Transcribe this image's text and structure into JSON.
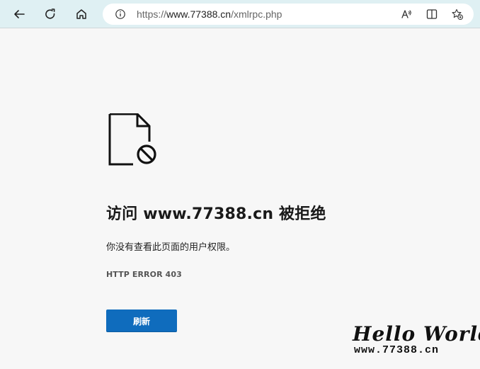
{
  "browser": {
    "address": {
      "prefix": "https://",
      "host": "www.77388.cn",
      "path": "/xmlrpc.php"
    },
    "icons": {
      "back": "arrow-left-icon",
      "refresh": "reload-icon",
      "home": "home-icon",
      "info": "info-icon",
      "read_aloud": "read-aloud-icon",
      "split_screen": "split-screen-icon",
      "favorites": "favorites-add-icon"
    }
  },
  "page": {
    "title": "访问 www.77388.cn 被拒绝",
    "description": "你没有查看此页面的用户权限。",
    "error_code": "HTTP ERROR 403",
    "refresh_label": "刷新"
  },
  "watermark": {
    "line1": "Hello World",
    "line2": "www.77388.cn"
  },
  "colors": {
    "toolbar_bg": "#dff0f3",
    "page_bg": "#f7f7f7",
    "accent": "#0f6cbd"
  }
}
